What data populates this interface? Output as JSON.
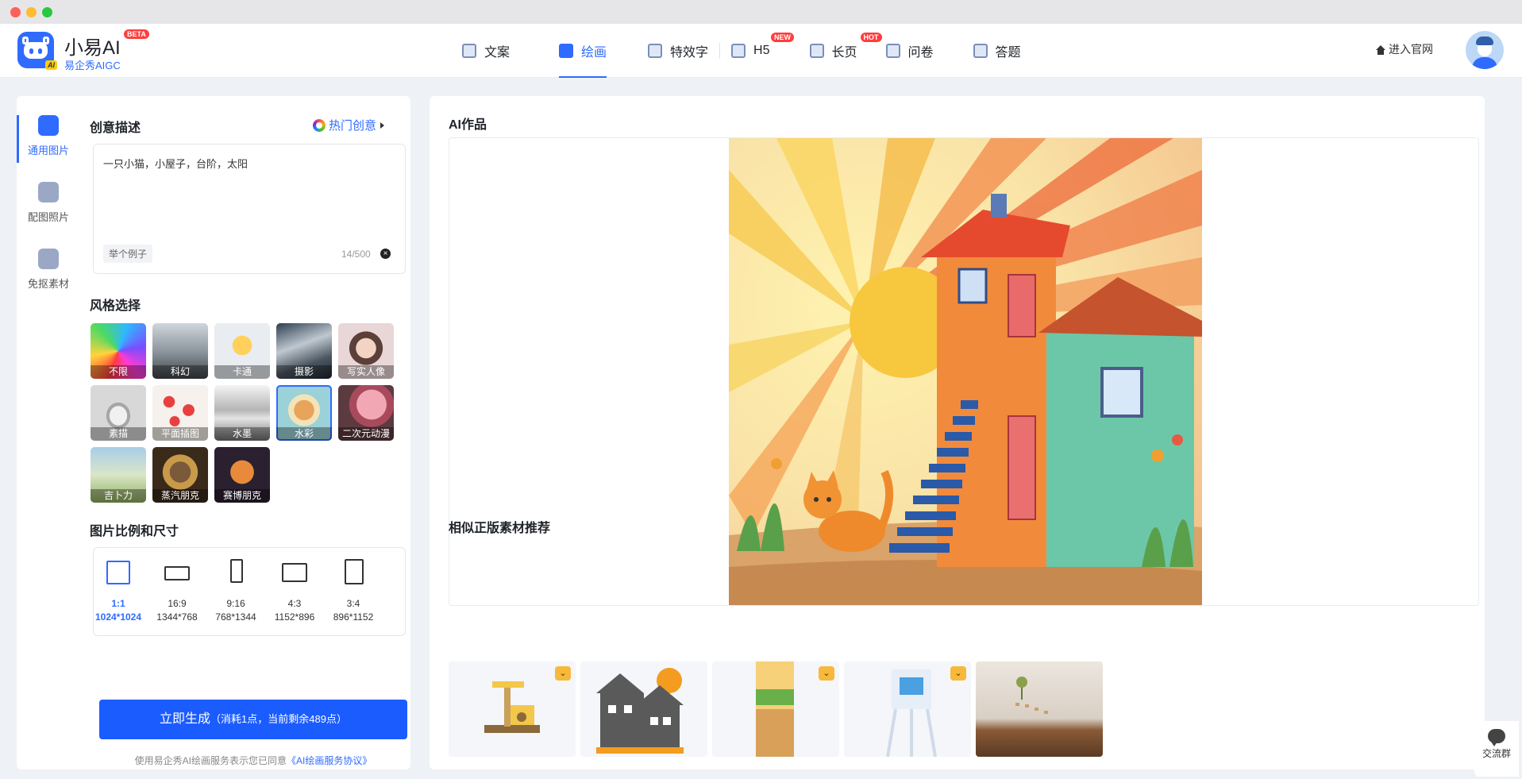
{
  "header": {
    "brand": "小易AI",
    "beta": "BETA",
    "subtitle": "易企秀AIGC",
    "nav": [
      {
        "label": "文案",
        "tag": ""
      },
      {
        "label": "绘画",
        "tag": ""
      },
      {
        "label": "特效字",
        "tag": ""
      },
      {
        "label": "H5",
        "tag": "NEW"
      },
      {
        "label": "长页",
        "tag": "HOT"
      },
      {
        "label": "问卷",
        "tag": ""
      },
      {
        "label": "答题",
        "tag": ""
      }
    ],
    "official": "进入官网"
  },
  "sidebar": {
    "items": [
      {
        "label": "通用图片"
      },
      {
        "label": "配图照片"
      },
      {
        "label": "免抠素材"
      }
    ]
  },
  "prompt": {
    "title": "创意描述",
    "hot": "热门创意",
    "value": "一只小猫，小屋子，台阶，太阳",
    "example": "举个例子",
    "count": "14/500"
  },
  "styles": {
    "title": "风格选择",
    "items": [
      {
        "label": "不限"
      },
      {
        "label": "科幻"
      },
      {
        "label": "卡通"
      },
      {
        "label": "摄影"
      },
      {
        "label": "写实人像"
      },
      {
        "label": "素描"
      },
      {
        "label": "平面插图"
      },
      {
        "label": "水墨"
      },
      {
        "label": "水彩"
      },
      {
        "label": "二次元动漫"
      },
      {
        "label": "吉卜力"
      },
      {
        "label": "蒸汽朋克"
      },
      {
        "label": "赛博朋克"
      }
    ],
    "selected": "水彩"
  },
  "ratio": {
    "title": "图片比例和尺寸",
    "items": [
      {
        "ratio": "1:1",
        "size": "1024*1024"
      },
      {
        "ratio": "16:9",
        "size": "1344*768"
      },
      {
        "ratio": "9:16",
        "size": "768*1344"
      },
      {
        "ratio": "4:3",
        "size": "1152*896"
      },
      {
        "ratio": "3:4",
        "size": "896*1152"
      }
    ]
  },
  "generate": {
    "label": "立即生成",
    "sub": "（消耗1点，当前剩余489点）"
  },
  "agreement": {
    "text": "使用易企秀AI绘画服务表示您已同意",
    "link": "《AI绘画服务协议》"
  },
  "result": {
    "title": "AI作品",
    "rec_title": "相似正版素材推荐"
  },
  "chat": {
    "label": "交流群"
  }
}
